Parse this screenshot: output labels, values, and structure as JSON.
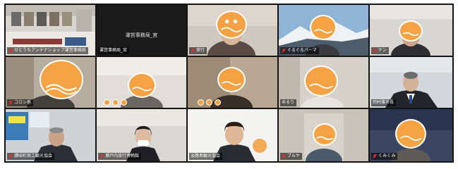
{
  "meeting": {
    "participants": [
      {
        "name": "せとうちアンテナショップ運営事務局",
        "muted": true
      },
      {
        "name": "運営事務局_宮",
        "muted": false,
        "center_label": "運営事務局_宮"
      },
      {
        "name": "実行",
        "muted": true
      },
      {
        "name": "ぐるぐるパーマ",
        "muted": true
      },
      {
        "name": "ケン",
        "muted": true
      },
      {
        "name": "コロン系",
        "muted": true
      },
      {
        "name": "",
        "muted": false
      },
      {
        "name": "",
        "muted": false
      },
      {
        "name": "ゆるり",
        "muted": false
      },
      {
        "name": "岡村雅市長",
        "muted": false
      },
      {
        "name": "讃岐町商工観光協会",
        "muted": true
      },
      {
        "name": "瀬戸内旅行博物館",
        "muted": true
      },
      {
        "name": "淡路島観光協会",
        "muted": false
      },
      {
        "name": "プルヤ",
        "muted": true
      },
      {
        "name": "くみくみ",
        "muted": true
      }
    ]
  },
  "colors": {
    "mask_orange": "#f4a244",
    "active_speaker_border": "#7ed957",
    "grid_background": "#141414",
    "muted_icon": "#e0312e"
  }
}
